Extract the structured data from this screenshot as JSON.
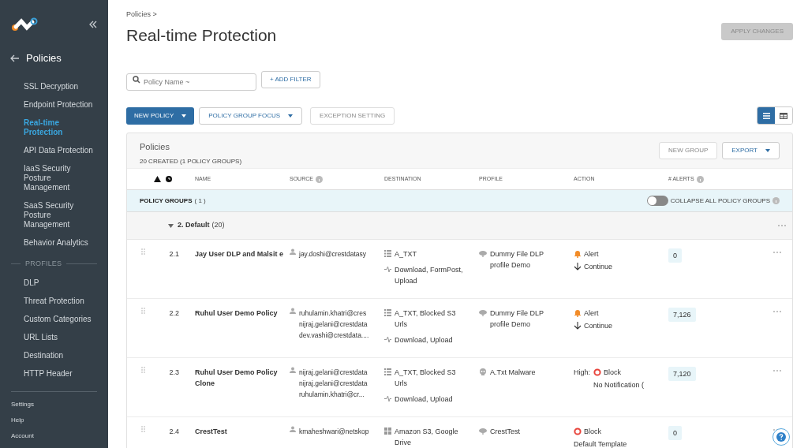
{
  "sidebar": {
    "back_label": "Policies",
    "items": [
      {
        "label": "SSL Decryption",
        "selected": false
      },
      {
        "label": "Endpoint Protection",
        "selected": false
      },
      {
        "label": "Real-time Protection",
        "selected": true
      },
      {
        "label": "API Data Protection",
        "selected": false
      },
      {
        "label": "IaaS Security Posture Management",
        "selected": false
      },
      {
        "label": "SaaS Security Posture Management",
        "selected": false
      },
      {
        "label": "Behavior Analytics",
        "selected": false
      }
    ],
    "section_title": "PROFILES",
    "profile_items": [
      {
        "label": "DLP",
        "selected": false
      },
      {
        "label": "Threat Protection",
        "selected": false
      },
      {
        "label": "Custom Categories",
        "selected": false
      },
      {
        "label": "URL Lists",
        "selected": false
      },
      {
        "label": "Destination",
        "selected": false
      },
      {
        "label": "HTTP Header",
        "selected": false
      }
    ],
    "footer_links": [
      "Settings",
      "Help",
      "Account"
    ]
  },
  "breadcrumb": "Policies >",
  "title": "Real-time Protection",
  "apply_button": {
    "label": "APPLY CHANGES",
    "disabled": true
  },
  "search": {
    "placeholder": "Policy Name ~"
  },
  "add_filter": "+ ADD FILTER",
  "toolbar": {
    "new_policy": "NEW POLICY",
    "group_focus": "POLICY GROUP FOCUS",
    "exception": "EXCEPTION SETTING",
    "views": [
      {
        "kind": "list",
        "selected": true
      },
      {
        "kind": "table",
        "selected": false
      }
    ]
  },
  "panel": {
    "title": "Policies",
    "subtitle": "20 CREATED (1 POLICY GROUPS)",
    "new_group": "NEW GROUP",
    "export": "EXPORT"
  },
  "table": {
    "columns": [
      {
        "label": "NAME",
        "kind": "plain"
      },
      {
        "label": "SOURCE",
        "kind": "info"
      },
      {
        "label": "DESTINATION",
        "kind": "plain"
      },
      {
        "label": "PROFILE",
        "kind": "plain"
      },
      {
        "label": "ACTION",
        "kind": "plain"
      },
      {
        "label": "# ALERTS",
        "kind": "info"
      }
    ],
    "groups_label": "POLICY GROUPS",
    "groups_count": "( 1 )",
    "collapse_label": "COLLAPSE ALL POLICY GROUPS",
    "collapse_on": false,
    "group": {
      "name": "2. Default",
      "count": "(20)",
      "expanded": true
    },
    "rows": [
      {
        "number": "2.1",
        "name": "Jay User DLP and Malsit e",
        "sources": [
          "jay.doshi@crestdatasy"
        ],
        "destinations": [
          {
            "kind": "list",
            "text": "A_TXT"
          },
          {
            "kind": "activity",
            "text": "Download, FormPost, Upload"
          }
        ],
        "profile": {
          "kind": "cloud",
          "text": "Dummy File DLP profile Demo"
        },
        "severity": "",
        "actions": [
          {
            "kind": "alert",
            "text": "Alert"
          },
          {
            "kind": "continue",
            "text": "Continue"
          }
        ],
        "alerts": "0"
      },
      {
        "number": "2.2",
        "name": "Ruhul User Demo Policy",
        "sources": [
          "ruhulamin.khatri@cres",
          "nijraj.gelani@crestdata",
          "dev.vashi@crestdata...."
        ],
        "destinations": [
          {
            "kind": "list",
            "text": "A_TXT, Blocked S3 Urls"
          },
          {
            "kind": "activity",
            "text": "Download, Upload"
          }
        ],
        "profile": {
          "kind": "cloud",
          "text": "Dummy File DLP profile Demo"
        },
        "severity": "",
        "actions": [
          {
            "kind": "alert",
            "text": "Alert"
          },
          {
            "kind": "continue",
            "text": "Continue"
          }
        ],
        "alerts": "7,126"
      },
      {
        "number": "2.3",
        "name": "Ruhul User Demo Policy Clone",
        "sources": [
          "nijraj.gelani@crestdata",
          "nijraj.gelani@crestdata",
          "ruhulamin.khatri@cr..."
        ],
        "destinations": [
          {
            "kind": "list",
            "text": "A_TXT, Blocked S3 Urls"
          },
          {
            "kind": "activity",
            "text": "Download, Upload"
          }
        ],
        "profile": {
          "kind": "skull",
          "text": "A.Txt Malware"
        },
        "severity": "High:",
        "actions": [
          {
            "kind": "block",
            "text": "Block"
          },
          {
            "kind": "note",
            "text": "No Notification ("
          }
        ],
        "alerts": "7,120"
      },
      {
        "number": "2.4",
        "name": "CrestTest",
        "sources": [
          "kmaheshwari@netskop"
        ],
        "destinations": [
          {
            "kind": "apps",
            "text": "Amazon S3, Google Drive"
          }
        ],
        "profile": {
          "kind": "cloud",
          "text": "CrestTest"
        },
        "severity": "",
        "actions": [
          {
            "kind": "block",
            "text": "Block"
          },
          {
            "kind": "note",
            "text": "Default Template"
          }
        ],
        "alerts": "0"
      }
    ]
  }
}
